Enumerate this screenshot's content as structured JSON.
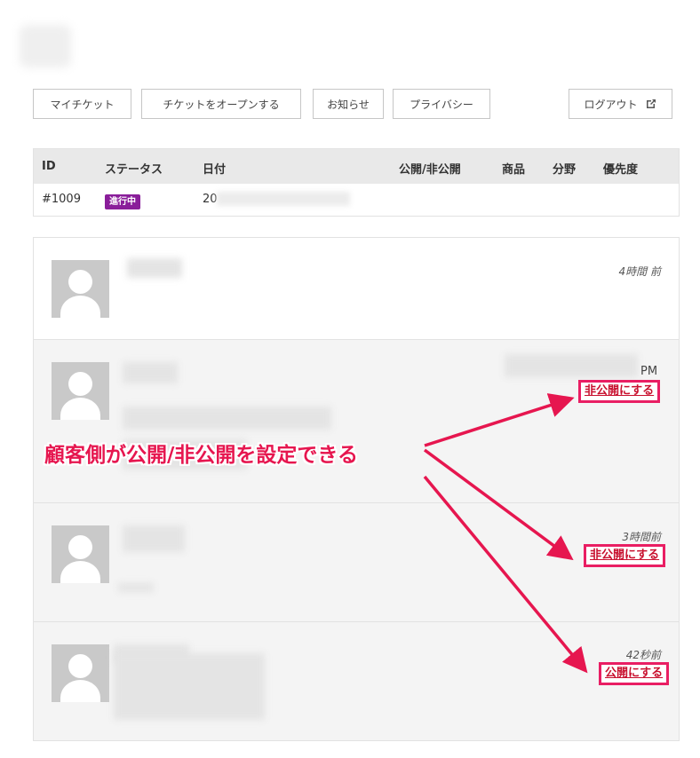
{
  "nav": {
    "my_tickets": "マイチケット",
    "open_ticket": "チケットをオープンする",
    "news": "お知らせ",
    "privacy": "プライバシー",
    "logout": "ログアウト"
  },
  "ticket_table": {
    "headers": [
      "ID",
      "ステータス",
      "日付",
      "公開/非公開",
      "商品",
      "分野",
      "優先度"
    ],
    "row": {
      "id": "#1009",
      "status": "進行中",
      "date": "20"
    },
    "status_color": "#8a1e9a"
  },
  "messages": [
    {
      "time": "4時間 前"
    },
    {
      "time_suffix": "PM",
      "visibility_action": "非公開にする"
    },
    {
      "time": "3時間前",
      "visibility_action": "非公開にする"
    },
    {
      "time": "42秒前",
      "visibility_action": "公開にする"
    }
  ],
  "annotation": {
    "callout": "顧客側が公開/非公開を設定できる",
    "color": "#e6164f"
  }
}
